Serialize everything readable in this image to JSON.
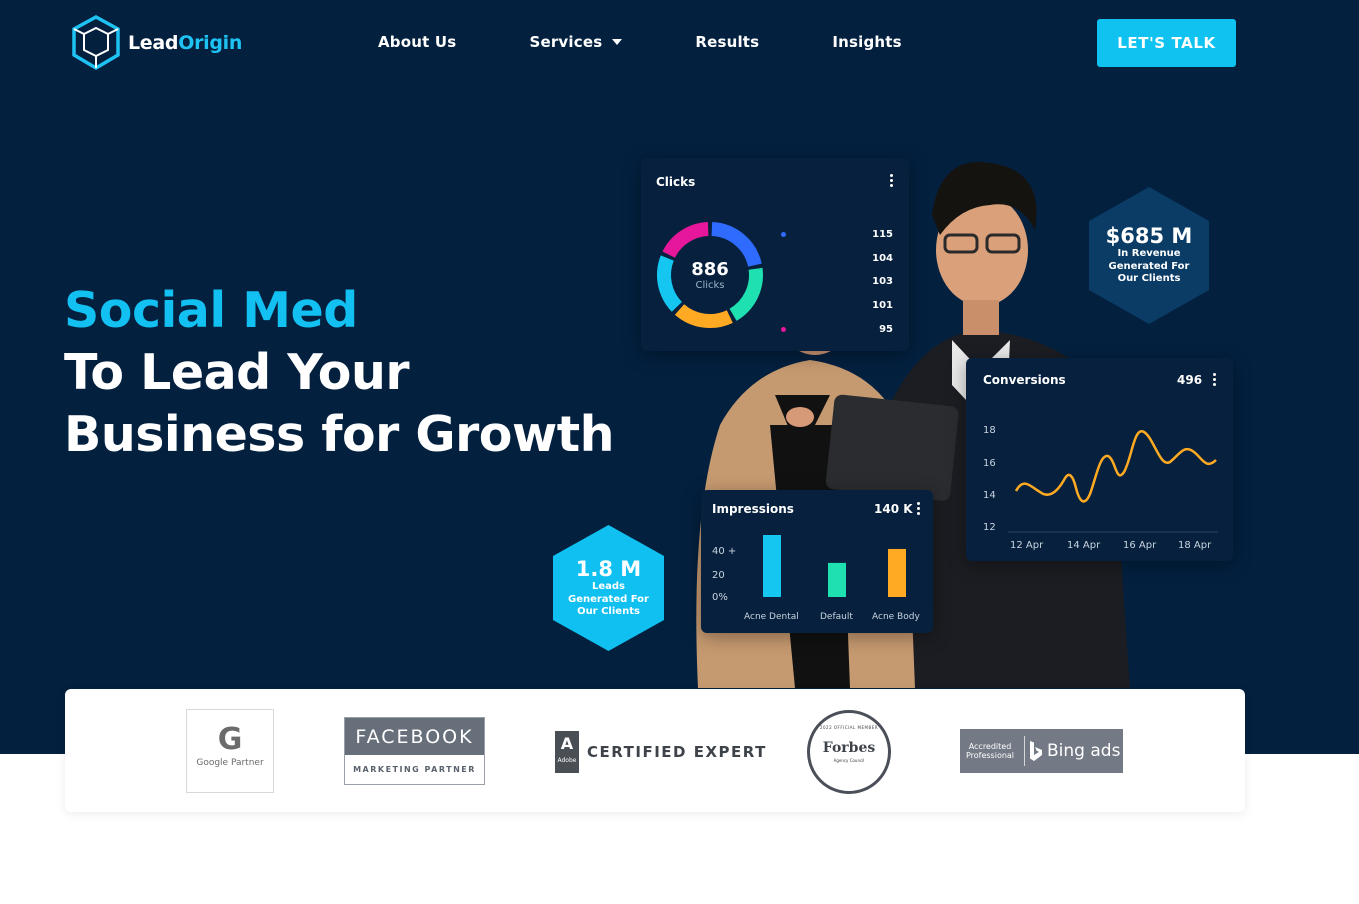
{
  "brand": {
    "name_part1": "Lead",
    "name_part2": "Origin",
    "accent_color": "#1ec3f3",
    "background": "#03203f"
  },
  "nav": {
    "items": [
      {
        "label": "About Us"
      },
      {
        "label": "Services"
      },
      {
        "label": "Results"
      },
      {
        "label": "Insights"
      }
    ],
    "cta_label": "LET'S TALK"
  },
  "hero": {
    "headline_accent": "Social Med",
    "headline_line2": "To Lead Your",
    "headline_line3": "Business for Growth"
  },
  "stats": {
    "revenue": {
      "value": "$685 M",
      "line1": "In Revenue",
      "line2": "Generated For",
      "line3": "Our Clients"
    },
    "leads": {
      "value": "1.8 M",
      "line1": "Leads",
      "line2": "Generated For",
      "line3": "Our Clients"
    }
  },
  "clicks_card": {
    "title": "Clicks",
    "total": "886",
    "total_label": "Clicks",
    "legend_values": [
      "115",
      "104",
      "103",
      "101",
      "95"
    ],
    "segment_colors": [
      "#2f6bff",
      "#1ee0b0",
      "#ffaa22",
      "#14c6f0",
      "#e6179b"
    ]
  },
  "conversions_card": {
    "title": "Conversions",
    "value": "496",
    "y_ticks": [
      "18",
      "16",
      "14",
      "12"
    ],
    "x_ticks": [
      "12 Apr",
      "14 Apr",
      "16 Apr",
      "18 Apr"
    ]
  },
  "impressions_card": {
    "title": "Impressions",
    "value": "140 K",
    "y_ticks": [
      "40 +",
      "20",
      "0%"
    ],
    "categories": [
      "Acne Dental",
      "Default",
      "Acne Body"
    ],
    "bar_values": [
      40,
      22,
      31
    ],
    "bar_colors": [
      "#14c6f0",
      "#1ee0b0",
      "#ffaa22"
    ]
  },
  "partners": {
    "google": {
      "letter": "G",
      "text": "Google Partner"
    },
    "facebook": {
      "title": "FACEBOOK",
      "subtitle": "MARKETING PARTNER"
    },
    "adobe": {
      "logo": "A",
      "logo_sub": "Adobe",
      "text": "CERTIFIED EXPERT"
    },
    "forbes": {
      "top": "2022 OFFICIAL MEMBER",
      "main": "Forbes",
      "sub": "Agency Council"
    },
    "bing": {
      "line1": "Accredited",
      "line2": "Professional",
      "text": "Bing ads"
    }
  }
}
